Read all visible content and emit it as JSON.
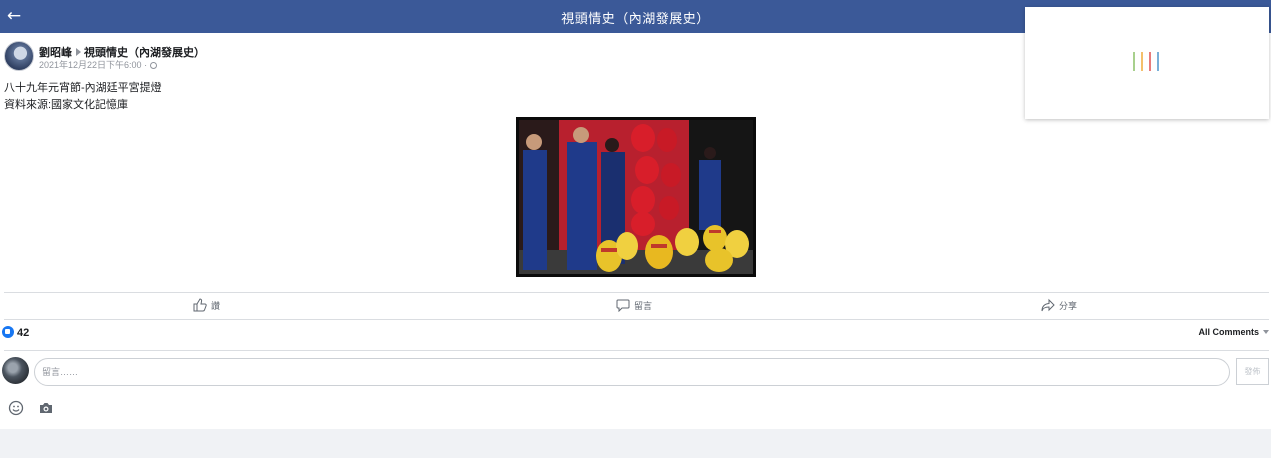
{
  "topbar": {
    "back_icon": "back-arrow-icon",
    "back_glyph": "←",
    "title": "視頭情史（內湖發展史）",
    "background": "#3b5998"
  },
  "post": {
    "author": "劉昭峰",
    "group": "視頭情史（內湖發展史）",
    "timestamp": "2021年12月22日下午6:00",
    "separator": "·",
    "text_lines": [
      "八十九年元宵節-內湖廷平宮提燈",
      "資料來源:國家文化記憶庫"
    ]
  },
  "loader": {
    "colors": [
      "#a8d08d",
      "#f4c06b",
      "#e87b7b",
      "#7ab0d8"
    ]
  },
  "actions": {
    "like": "讚",
    "comment": "留言",
    "share": "分享"
  },
  "reactions": {
    "count": "42",
    "all_comments": "All Comments"
  },
  "composer": {
    "placeholder": "留言……",
    "post_button": "發佈"
  },
  "colors": {
    "accent": "#1877f2",
    "divider": "#dadde1"
  }
}
